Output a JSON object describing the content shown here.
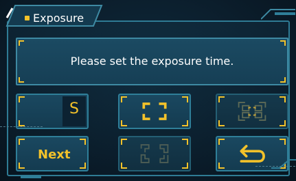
{
  "panel": {
    "title": "Exposure",
    "message": "Please set the exposure time."
  },
  "buttons": {
    "shutter_value": "S",
    "fullscreen_icon": "fullscreen-corners-icon",
    "focus_frame_icon": "focus-frame-icon",
    "crop_frame_icon": "crop-frame-icon",
    "next_label": "Next",
    "back_icon": "return-arrow-icon"
  },
  "colors": {
    "accent": "#f3c22a",
    "frame": "#2f7f99",
    "background": "#0b1c2a",
    "text": "#ffffff"
  }
}
